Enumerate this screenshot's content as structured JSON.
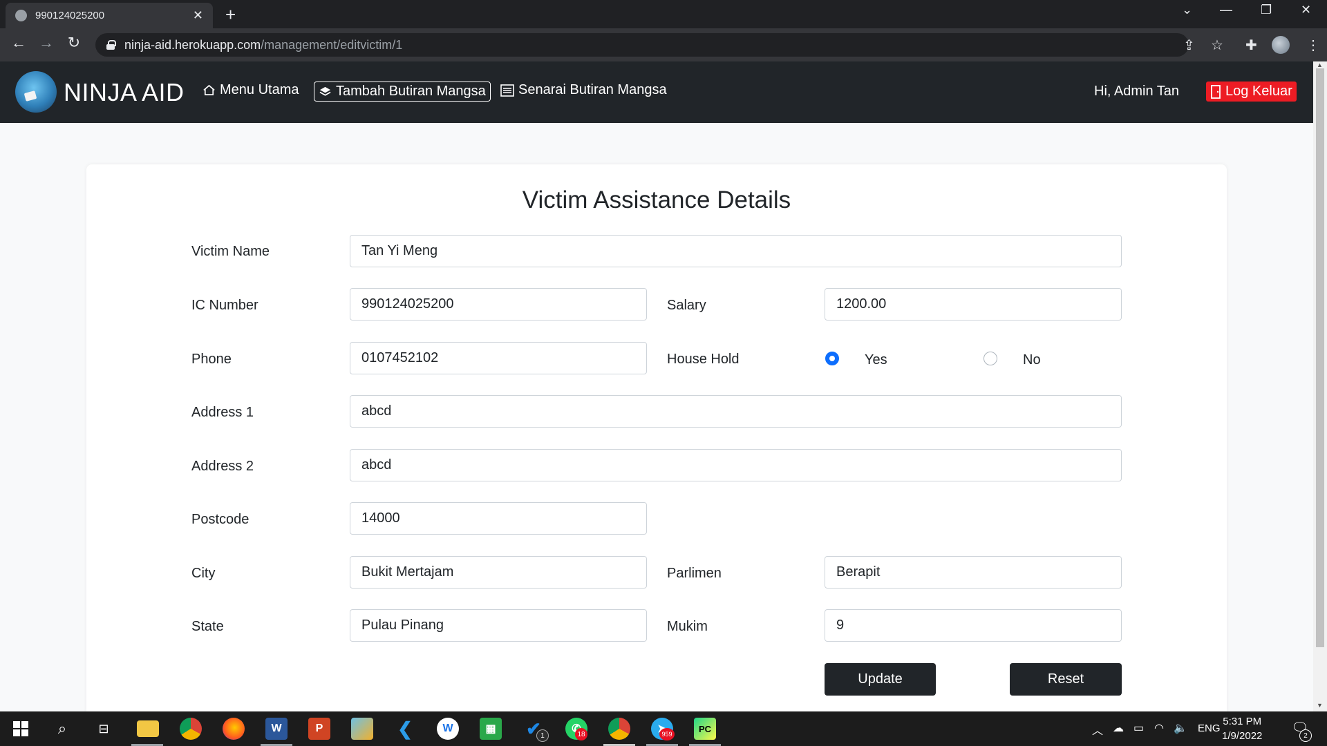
{
  "browser": {
    "tab_title": "990124025200",
    "url_host": "ninja-aid.herokuapp.com",
    "url_path": "/management/editvictim/1"
  },
  "navbar": {
    "brand": "NINJA AID",
    "links": [
      {
        "label": "Menu Utama",
        "icon": "home-icon"
      },
      {
        "label": "Tambah Butiran Mangsa",
        "icon": "layers-icon"
      },
      {
        "label": "Senarai Butiran Mangsa",
        "icon": "list-icon"
      }
    ],
    "greeting": "Hi, Admin Tan",
    "logout_label": "Log Keluar",
    "logout_color": "#ed1c24"
  },
  "form": {
    "title": "Victim Assistance Details",
    "victim_name": {
      "label": "Victim Name",
      "value": "Tan Yi Meng"
    },
    "ic_number": {
      "label": "IC Number",
      "value": "990124025200"
    },
    "salary": {
      "label": "Salary",
      "value": "1200.00"
    },
    "phone": {
      "label": "Phone",
      "value": "0107452102"
    },
    "household": {
      "label": "House Hold",
      "yes": "Yes",
      "no": "No",
      "selected": "Yes"
    },
    "address1": {
      "label": "Address 1",
      "value": "abcd"
    },
    "address2": {
      "label": "Address 2",
      "value": "abcd"
    },
    "postcode": {
      "label": "Postcode",
      "value": "14000"
    },
    "city": {
      "label": "City",
      "value": "Bukit Mertajam"
    },
    "parlimen": {
      "label": "Parlimen",
      "value": "Berapit"
    },
    "state": {
      "label": "State",
      "value": "Pulau Pinang"
    },
    "mukim": {
      "label": "Mukim",
      "value": "9"
    },
    "update_label": "Update",
    "reset_label": "Reset"
  },
  "taskbar": {
    "whatsapp_badge": "18",
    "telegram_badge": "959",
    "todo_badge": "1",
    "lang": "ENG",
    "time": "5:31 PM",
    "date": "1/9/2022",
    "notifications": "2"
  }
}
